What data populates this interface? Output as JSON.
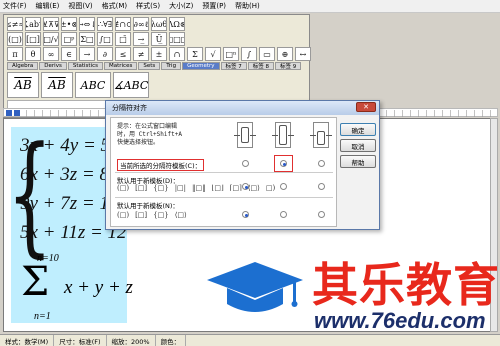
{
  "menubar": {
    "items": [
      "文件(F)",
      "编辑(E)",
      "视图(V)",
      "格式(M)",
      "样式(S)",
      "大小(Z)",
      "预置(P)",
      "帮助(H)"
    ]
  },
  "palette": {
    "row1": [
      "≤≠≈",
      "∡ab∵",
      "⊻⊼⊽",
      "±•⊗",
      "→⇔↓",
      "∴∀∃",
      "∉∩⊂",
      "∂∞ℓ",
      "λωθ",
      "ΛΩ⊗"
    ],
    "row2": [
      "(□)",
      "[□]",
      "□/√",
      "□ᵖ",
      "Σ□",
      "∫□",
      "□̄",
      "→̲",
      "Ü̲",
      "□□□"
    ],
    "row3": [
      "π",
      "θ",
      "∞",
      "∈",
      "→",
      "∂",
      "≤",
      "≠",
      "±",
      "∩",
      "Σ",
      "√",
      "□ⁿ",
      "∫",
      "▭",
      "⊕",
      "↔"
    ],
    "tabs": [
      "Algebra",
      "Derivs",
      "Statistics",
      "Matrices",
      "Sets",
      "Trig",
      "Geometry",
      "标签 7",
      "标签 8",
      "标签 9"
    ],
    "active_tab": "Geometry",
    "big_templates": [
      "AB",
      "AB",
      "ABC",
      "∡ABC"
    ]
  },
  "equations": {
    "line1": "3x + 4y = 5z",
    "line2": "6x + 3z = 8a",
    "line3": "9y + 7z = 1€",
    "line4": "5x + 11z = 12",
    "sum_upper": "n=10",
    "sum_symbol": "Σ",
    "sum_body": "x + y + z",
    "sum_lower": "n=1"
  },
  "dialog": {
    "title": "分隔符对齐",
    "close": "✕",
    "note": "提示：在公式窗口编辑\n时，用 Ctrl+Shift+A\n快捷选择按钮。",
    "row_current": "当前所选的分隔符模板(C)：",
    "row_default_d": "默认用于新模板(D)：",
    "row_default_n": "默认用于新模板(N)：",
    "templates_d": [
      "(□)",
      "[□]",
      "{□}",
      "|□|",
      "‖□‖",
      "⌊□⌋",
      "⌈□⌉",
      "⟨□⟩",
      "□)"
    ],
    "templates_n": [
      "(□)",
      "[□]",
      "{□}",
      "⟨□⟩"
    ],
    "btn_ok": "确定",
    "btn_cancel": "取消",
    "btn_help": "帮助"
  },
  "statusbar": {
    "style": "样式：数学(M)",
    "size": "尺寸：标准(F)",
    "zoom": "缩放：200%",
    "color": "颜色："
  },
  "watermark": {
    "brand": "其乐教育",
    "url": "www.76edu.com"
  },
  "colors": {
    "highlight": "#bfeefe",
    "brand_red": "#e8281c",
    "brand_blue": "#1c6fd0",
    "url_navy": "#1c2f6a",
    "annotation_red": "#e03030"
  }
}
